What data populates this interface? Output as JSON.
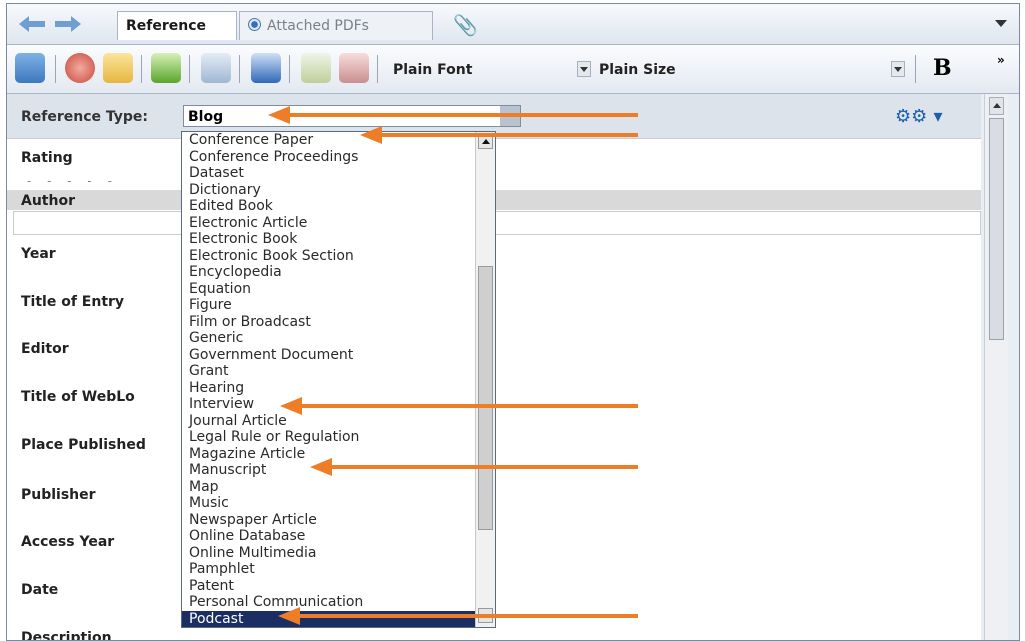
{
  "tabs": {
    "reference_label": "Reference",
    "pdfs_label": "Attached PDFs"
  },
  "toolbar": {
    "font_label": "Plain Font",
    "size_label": "Plain Size",
    "bold_label": "B",
    "more_label": "»"
  },
  "form": {
    "reference_type_label": "Reference Type:",
    "reference_type_value": "Blog",
    "fields": {
      "rating": "Rating",
      "author": "Author",
      "year": "Year",
      "title_of_entry": "Title of Entry",
      "editor": "Editor",
      "title_of_weblog": "Title of WebLo",
      "place_published": "Place Published",
      "publisher": "Publisher",
      "access_year": "Access Year",
      "date": "Date",
      "description": "Description"
    }
  },
  "dropdown": {
    "items": [
      "Conference Paper",
      "Conference Proceedings",
      "Dataset",
      "Dictionary",
      "Edited Book",
      "Electronic Article",
      "Electronic Book",
      "Electronic Book Section",
      "Encyclopedia",
      "Equation",
      "Figure",
      "Film or Broadcast",
      "Generic",
      "Government Document",
      "Grant",
      "Hearing",
      "Interview",
      "Journal Article",
      "Legal Rule or Regulation",
      "Magazine Article",
      "Manuscript",
      "Map",
      "Music",
      "Newspaper Article",
      "Online Database",
      "Online Multimedia",
      "Pamphlet",
      "Patent",
      "Personal Communication",
      "Podcast"
    ],
    "selected": "Podcast"
  },
  "colors": {
    "annotation_arrow": "#ee7d28",
    "selected_highlight": "#1b2e63"
  }
}
